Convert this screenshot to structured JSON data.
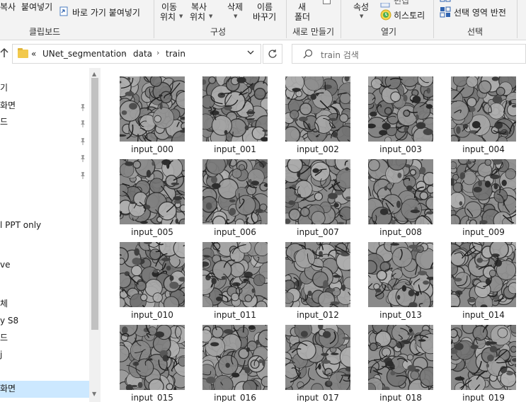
{
  "ribbon": {
    "clipboard": {
      "copy_label": "복사",
      "paste_label": "붙여넣기",
      "paste_shortcut_label": "바로 가기 붙여넣기",
      "group_label": "클립보드"
    },
    "organize": {
      "move_to_line1": "이동",
      "move_to_line2": "위치",
      "copy_to_line1": "복사",
      "copy_to_line2": "위치",
      "delete_label": "삭제",
      "rename_line1": "이름",
      "rename_line2": "바꾸기",
      "group_label": "구성"
    },
    "new": {
      "new_folder_line1": "새",
      "new_folder_line2": "폴더",
      "group_label": "새로 만들기"
    },
    "open": {
      "properties_label": "속성",
      "edit_label": "편집",
      "history_label": "히스토리",
      "group_label": "열기"
    },
    "select": {
      "invert_selection_label": "선택 영역 반전",
      "group_label": "선택"
    }
  },
  "address": {
    "overflow": "«",
    "crumbs": [
      "UNet_segmentation",
      "data",
      "train"
    ],
    "separator": "›"
  },
  "search": {
    "placeholder": "train 검색"
  },
  "sidebar": {
    "items": [
      {
        "label": "기",
        "pinned": false
      },
      {
        "label": "화면",
        "pinned": true
      },
      {
        "label": "드",
        "pinned": true
      },
      {
        "label": "",
        "pinned": true
      },
      {
        "label": "",
        "pinned": true
      },
      {
        "label": "",
        "pinned": true
      },
      {
        "label": "l PPT only",
        "pinned": false
      },
      {
        "label": "ve",
        "pinned": false
      },
      {
        "label": "체",
        "pinned": false
      },
      {
        "label": "y S8",
        "pinned": false
      },
      {
        "label": "드",
        "pinned": false
      },
      {
        "label": "j",
        "pinned": false
      },
      {
        "label": "화면",
        "pinned": false
      }
    ],
    "selected_index": 12
  },
  "files": [
    {
      "name": "input_000"
    },
    {
      "name": "input_001"
    },
    {
      "name": "input_002"
    },
    {
      "name": "input_003"
    },
    {
      "name": "input_004"
    },
    {
      "name": "input_005"
    },
    {
      "name": "input_006"
    },
    {
      "name": "input_007"
    },
    {
      "name": "input_008"
    },
    {
      "name": "input_009"
    },
    {
      "name": "input_010"
    },
    {
      "name": "input_011"
    },
    {
      "name": "input_012"
    },
    {
      "name": "input_013"
    },
    {
      "name": "input_014"
    },
    {
      "name": "input_015"
    },
    {
      "name": "input_016"
    },
    {
      "name": "input_017"
    },
    {
      "name": "input_018"
    },
    {
      "name": "input_019"
    }
  ],
  "colors": {
    "selection": "#cce8ff",
    "folder": "#f2c94c",
    "ribbon_bg": "#f3f3f3"
  }
}
